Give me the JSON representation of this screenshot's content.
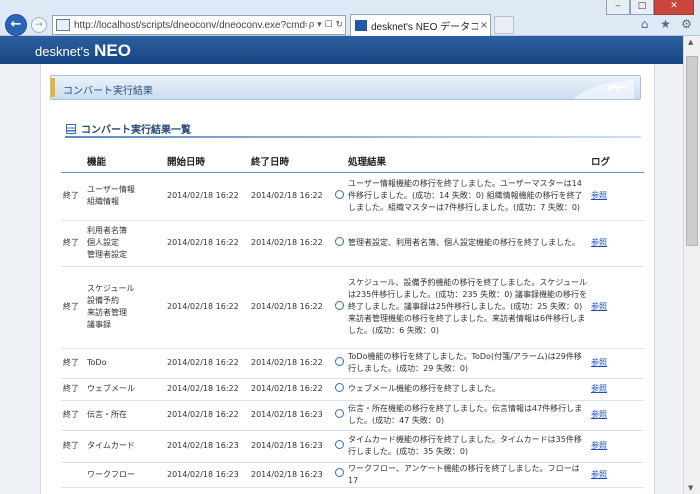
{
  "browser": {
    "url": "http://localhost/scripts/dneoconv/dneoconv.exe?cmd=co",
    "address_controls": "ρ ▾ ☐ ↻",
    "tab_title": "desknet's NEO データコンバ...",
    "tab_close": "×",
    "window_buttons": [
      "‒",
      "□",
      "✕"
    ],
    "tools": [
      "⌂",
      "★",
      "⚙"
    ]
  },
  "app": {
    "logo_prefix": "desknet's",
    "logo_brand": "NEO"
  },
  "page": {
    "title": "コンバート実行結果",
    "section_title": "コンバート実行結果一覧"
  },
  "table": {
    "headers": {
      "function": "機能",
      "start": "開始日時",
      "end": "終了日時",
      "result": "処理結果",
      "log": "ログ"
    },
    "rows": [
      {
        "status": "終了",
        "functions": [
          "ユーザー情報",
          "組織情報"
        ],
        "start": "2014/02/18 16:22",
        "end": "2014/02/18 16:22",
        "result": "ユーザー情報機能の移行を終了しました。ユーザーマスターは14件移行しました。(成功：14 失敗：0) 組織情報機能の移行を終了しました。組織マスターは7件移行しました。(成功：7 失敗：0)",
        "log": "参照"
      },
      {
        "status": "終了",
        "functions": [
          "利用者名簿",
          "個人設定",
          "管理者設定"
        ],
        "start": "2014/02/18 16:22",
        "end": "2014/02/18 16:22",
        "result": "管理者設定、利用者名簿、個人設定機能の移行を終了しました。",
        "log": "参照"
      },
      {
        "status": "終了",
        "functions": [
          "スケジュール",
          "設備予約",
          "来訪者管理",
          "議事録"
        ],
        "start": "2014/02/18 16:22",
        "end": "2014/02/18 16:22",
        "result": "スケジュール、設備予約機能の移行を終了しました。スケジュールは235件移行しました。(成功：235 失敗：0) 議事録機能の移行を終了しました。議事録は25件移行しました。(成功：25 失敗：0) 来訪者管理機能の移行を終了しました。来訪者情報は6件移行しました。(成功：6 失敗：0)",
        "log": "参照"
      },
      {
        "status": "終了",
        "functions": [
          "ToDo"
        ],
        "start": "2014/02/18 16:22",
        "end": "2014/02/18 16:22",
        "result": "ToDo機能の移行を終了しました。ToDo(付箋/アラーム)は29件移行しました。(成功：29 失敗：0)",
        "log": "参照"
      },
      {
        "status": "終了",
        "functions": [
          "ウェブメール"
        ],
        "start": "2014/02/18 16:22",
        "end": "2014/02/18 16:22",
        "result": "ウェブメール機能の移行を終了しました。",
        "log": "参照"
      },
      {
        "status": "終了",
        "functions": [
          "伝言・所在"
        ],
        "start": "2014/02/18 16:22",
        "end": "2014/02/18 16:23",
        "result": "伝言・所在機能の移行を終了しました。伝言情報は47件移行しました。(成功：47 失敗：0)",
        "log": "参照"
      },
      {
        "status": "終了",
        "functions": [
          "タイムカード"
        ],
        "start": "2014/02/18 16:23",
        "end": "2014/02/18 16:23",
        "result": "タイムカード機能の移行を終了しました。タイムカードは35件移行しました。(成功：35 失敗：0)",
        "log": "参照"
      },
      {
        "status": "",
        "functions": [
          "ワークフロー"
        ],
        "start": "2014/02/18 16:23",
        "end": "2014/02/18 16:23",
        "result": "ワークフロー、アンケート機能の移行を終了しました。フローは17",
        "log": "参照"
      }
    ]
  },
  "colors": {
    "header_blue": "#174583",
    "accent_yellow": "#e6b520",
    "link_blue": "#1a4fc4",
    "ok_circle": "#2e6fc9"
  }
}
